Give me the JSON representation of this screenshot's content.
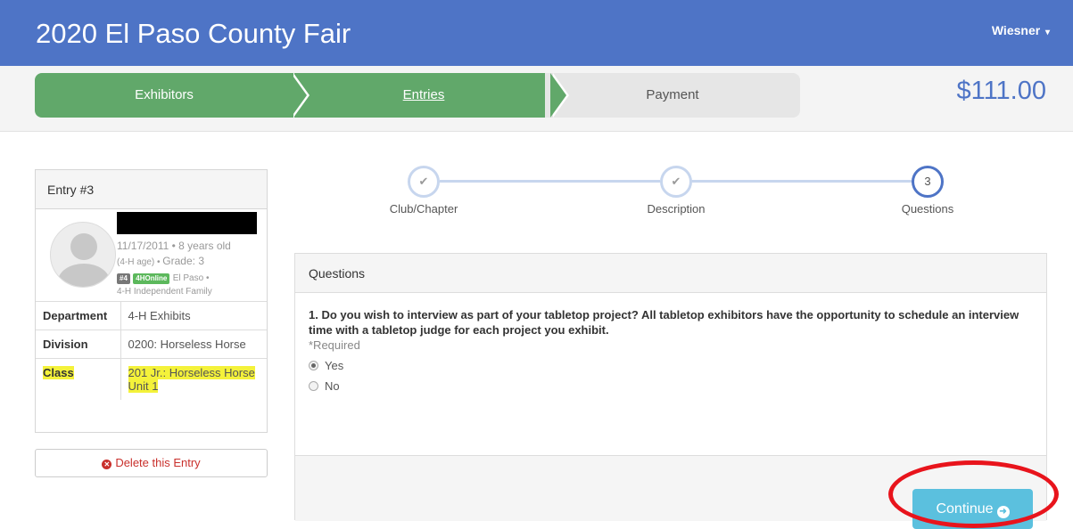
{
  "header": {
    "title": "2020 El Paso County Fair",
    "user_menu": "Wiesner"
  },
  "wizard": {
    "steps": [
      "Exhibitors",
      "Entries",
      "Payment"
    ],
    "active_step": "Entries",
    "total": "$111.00"
  },
  "entry": {
    "heading": "Entry #3",
    "dob_age": "11/17/2011 • 8 years old",
    "age_grade_prefix": "(4-H age) • ",
    "grade": "Grade: 3",
    "badge_number": "#4",
    "badge_source": "4HOnline",
    "county": "El Paso •",
    "club": "4-H Independent Family",
    "rows": [
      {
        "label": "Department",
        "value": "4-H Exhibits"
      },
      {
        "label": "Division",
        "value": "0200: Horseless Horse"
      },
      {
        "label": "Class",
        "value": "201 Jr.: Horseless Horse Unit 1"
      }
    ],
    "delete_label": "Delete this Entry"
  },
  "progress": {
    "steps": [
      {
        "label": "Club/Chapter",
        "marker": "✔",
        "state": "done"
      },
      {
        "label": "Description",
        "marker": "✔",
        "state": "done"
      },
      {
        "label": "Questions",
        "marker": "3",
        "state": "current"
      }
    ]
  },
  "questions": {
    "heading": "Questions",
    "q1": "1. Do you wish to interview as part of your tabletop project? All tabletop exhibitors have the opportunity to schedule an interview time with a tabletop judge for each project you exhibit.",
    "required": "*Required",
    "options": [
      "Yes",
      "No"
    ],
    "selected": "Yes",
    "continue_label": "Continue"
  },
  "colors": {
    "header_blue": "#4e74c6",
    "step_green": "#61a86a",
    "continue_blue": "#5bc0de",
    "annotation_red": "#e8141c",
    "highlight_yellow": "#f4f23a"
  }
}
